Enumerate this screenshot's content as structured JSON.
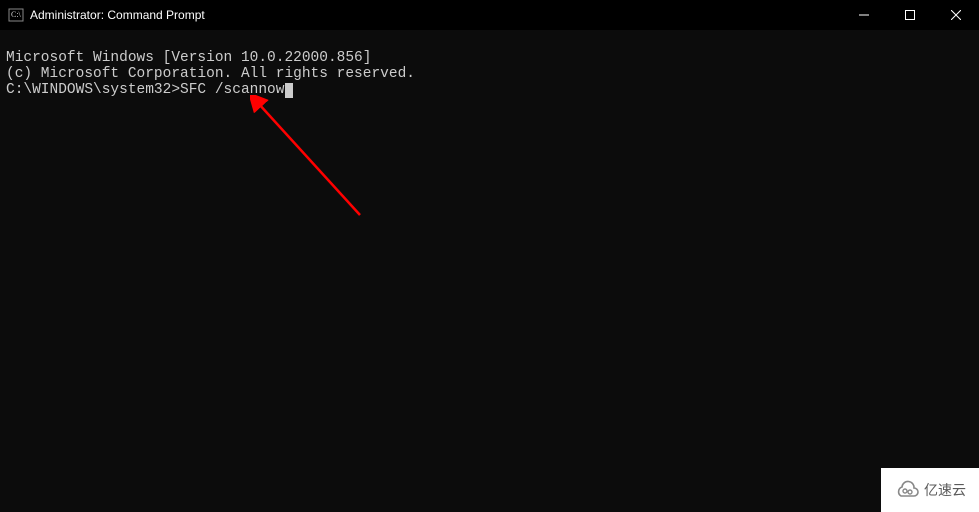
{
  "titlebar": {
    "title": "Administrator: Command Prompt"
  },
  "terminal": {
    "line1": "Microsoft Windows [Version 10.0.22000.856]",
    "line2": "(c) Microsoft Corporation. All rights reserved.",
    "blank": "",
    "prompt": "C:\\WINDOWS\\system32>",
    "command": "SFC /scannow"
  },
  "watermark": {
    "text": "亿速云"
  }
}
